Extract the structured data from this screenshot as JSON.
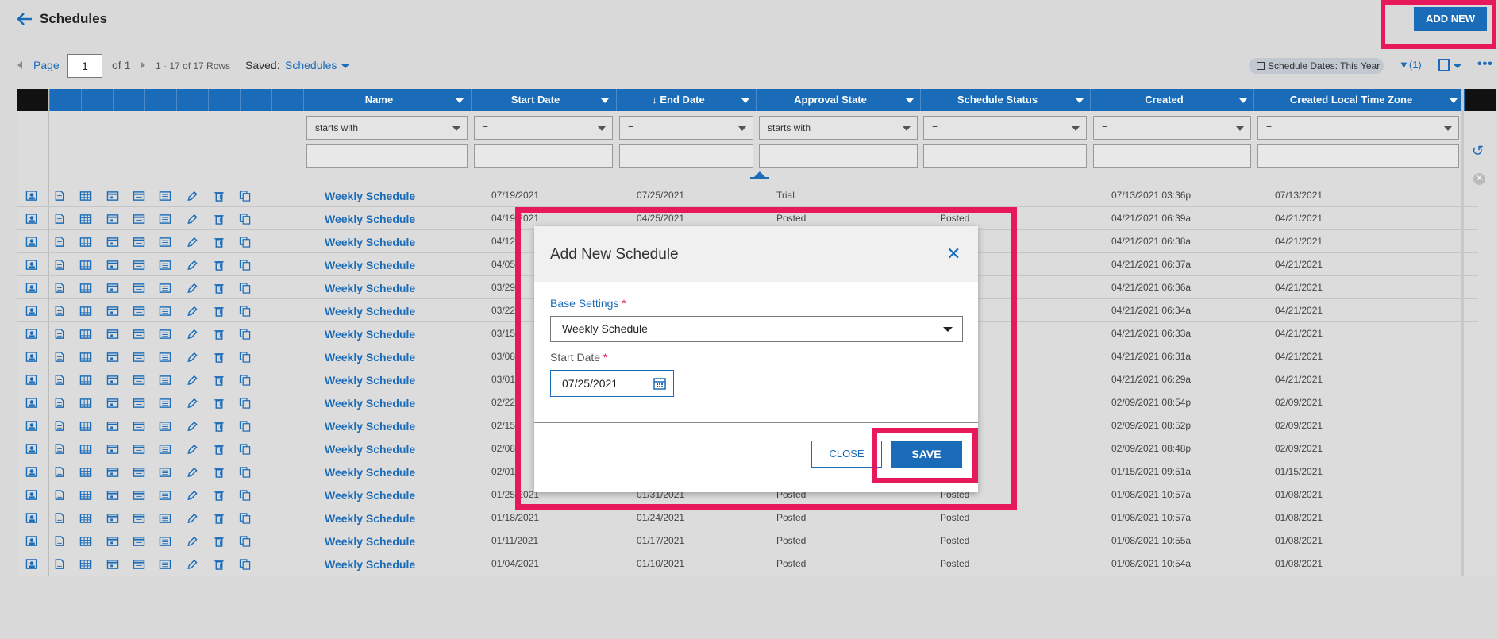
{
  "header": {
    "title": "Schedules",
    "add_new_label": "ADD NEW"
  },
  "pager": {
    "page_label": "Page",
    "page_value": "1",
    "of_label": "of 1",
    "rows_label": "1 - 17 of 17 Rows",
    "saved_label": "Saved:",
    "saved_value": "Schedules",
    "date_chip": "Schedule Dates: This Year",
    "filter_count": "(1)"
  },
  "columns": [
    {
      "label": "Name"
    },
    {
      "label": "Start Date"
    },
    {
      "label": "End Date"
    },
    {
      "label": "Approval State"
    },
    {
      "label": "Schedule Status"
    },
    {
      "label": "Created"
    },
    {
      "label": "Created Local Time Zone"
    }
  ],
  "filters": [
    "starts with",
    "=",
    "=",
    "starts with",
    "=",
    "=",
    "="
  ],
  "rows": [
    {
      "name": "Weekly Schedule",
      "start": "07/19/2021",
      "end": "07/25/2021",
      "approval": "Trial",
      "status": "",
      "created": "07/13/2021 03:36p",
      "local": "07/13/2021"
    },
    {
      "name": "Weekly Schedule",
      "start": "04/19/2021",
      "end": "04/25/2021",
      "approval": "Posted",
      "status": "Posted",
      "created": "04/21/2021 06:39a",
      "local": "04/21/2021"
    },
    {
      "name": "Weekly Schedule",
      "start": "04/12",
      "end": "",
      "approval": "",
      "status": "",
      "created": "04/21/2021 06:38a",
      "local": "04/21/2021"
    },
    {
      "name": "Weekly Schedule",
      "start": "04/05",
      "end": "",
      "approval": "",
      "status": "",
      "created": "04/21/2021 06:37a",
      "local": "04/21/2021"
    },
    {
      "name": "Weekly Schedule",
      "start": "03/29",
      "end": "",
      "approval": "",
      "status": "",
      "created": "04/21/2021 06:36a",
      "local": "04/21/2021"
    },
    {
      "name": "Weekly Schedule",
      "start": "03/22",
      "end": "",
      "approval": "",
      "status": "",
      "created": "04/21/2021 06:34a",
      "local": "04/21/2021"
    },
    {
      "name": "Weekly Schedule",
      "start": "03/15",
      "end": "",
      "approval": "",
      "status": "",
      "created": "04/21/2021 06:33a",
      "local": "04/21/2021"
    },
    {
      "name": "Weekly Schedule",
      "start": "03/08",
      "end": "",
      "approval": "",
      "status": "",
      "created": "04/21/2021 06:31a",
      "local": "04/21/2021"
    },
    {
      "name": "Weekly Schedule",
      "start": "03/01",
      "end": "",
      "approval": "",
      "status": "",
      "created": "04/21/2021 06:29a",
      "local": "04/21/2021"
    },
    {
      "name": "Weekly Schedule",
      "start": "02/22",
      "end": "",
      "approval": "",
      "status": "",
      "created": "02/09/2021 08:54p",
      "local": "02/09/2021"
    },
    {
      "name": "Weekly Schedule",
      "start": "02/15",
      "end": "",
      "approval": "",
      "status": "",
      "created": "02/09/2021 08:52p",
      "local": "02/09/2021"
    },
    {
      "name": "Weekly Schedule",
      "start": "02/08",
      "end": "",
      "approval": "",
      "status": "",
      "created": "02/09/2021 08:48p",
      "local": "02/09/2021"
    },
    {
      "name": "Weekly Schedule",
      "start": "02/01",
      "end": "",
      "approval": "",
      "status": "",
      "created": "01/15/2021 09:51a",
      "local": "01/15/2021"
    },
    {
      "name": "Weekly Schedule",
      "start": "01/25/2021",
      "end": "01/31/2021",
      "approval": "Posted",
      "status": "Posted",
      "created": "01/08/2021 10:57a",
      "local": "01/08/2021"
    },
    {
      "name": "Weekly Schedule",
      "start": "01/18/2021",
      "end": "01/24/2021",
      "approval": "Posted",
      "status": "Posted",
      "created": "01/08/2021 10:57a",
      "local": "01/08/2021"
    },
    {
      "name": "Weekly Schedule",
      "start": "01/11/2021",
      "end": "01/17/2021",
      "approval": "Posted",
      "status": "Posted",
      "created": "01/08/2021 10:55a",
      "local": "01/08/2021"
    },
    {
      "name": "Weekly Schedule",
      "start": "01/04/2021",
      "end": "01/10/2021",
      "approval": "Posted",
      "status": "Posted",
      "created": "01/08/2021 10:54a",
      "local": "01/08/2021"
    }
  ],
  "modal": {
    "title": "Add New Schedule",
    "base_settings_label": "Base Settings",
    "base_settings_value": "Weekly Schedule",
    "start_date_label": "Start Date",
    "start_date_value": "07/25/2021",
    "required_mark": "*",
    "close_label": "CLOSE",
    "save_label": "SAVE"
  },
  "colors": {
    "accent": "#1a6bb8",
    "highlight": "#e8195a"
  }
}
